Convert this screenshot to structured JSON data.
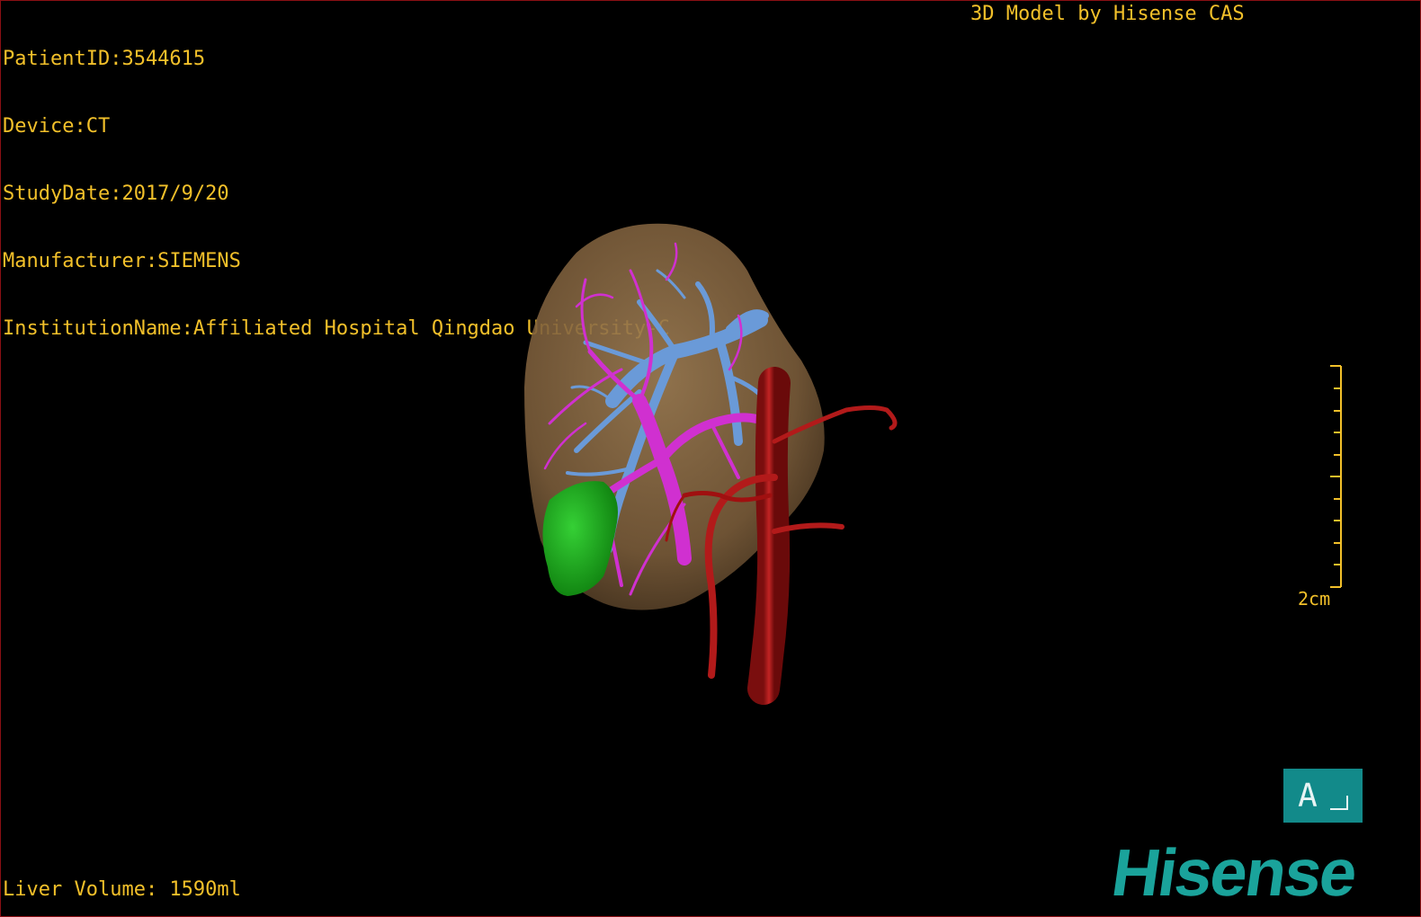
{
  "overlay": {
    "patient_id": "PatientID:3544615",
    "device": "Device:CT",
    "study_date": "StudyDate:2017/9/20",
    "manufacturer": "Manufacturer:SIEMENS",
    "institution": "InstitutionName:Affiliated Hospital Qingdao University-C",
    "credit": "3D Model by Hisense CAS",
    "liver_volume": "Liver Volume: 1590ml"
  },
  "scale": {
    "label": "2cm"
  },
  "orientation": {
    "letter": "A"
  },
  "logo": {
    "text": "Hisense"
  },
  "colors": {
    "overlay_text": "#f2c02a",
    "liver": "#8a6a44",
    "portal_vein": "#d030d0",
    "hepatic_vein": "#6a9ad8",
    "artery": "#b21a1a",
    "gallbladder": "#1fa81f",
    "orientation_box": "#128a8a",
    "logo": "#1aa39b",
    "border": "#8a0f14"
  }
}
